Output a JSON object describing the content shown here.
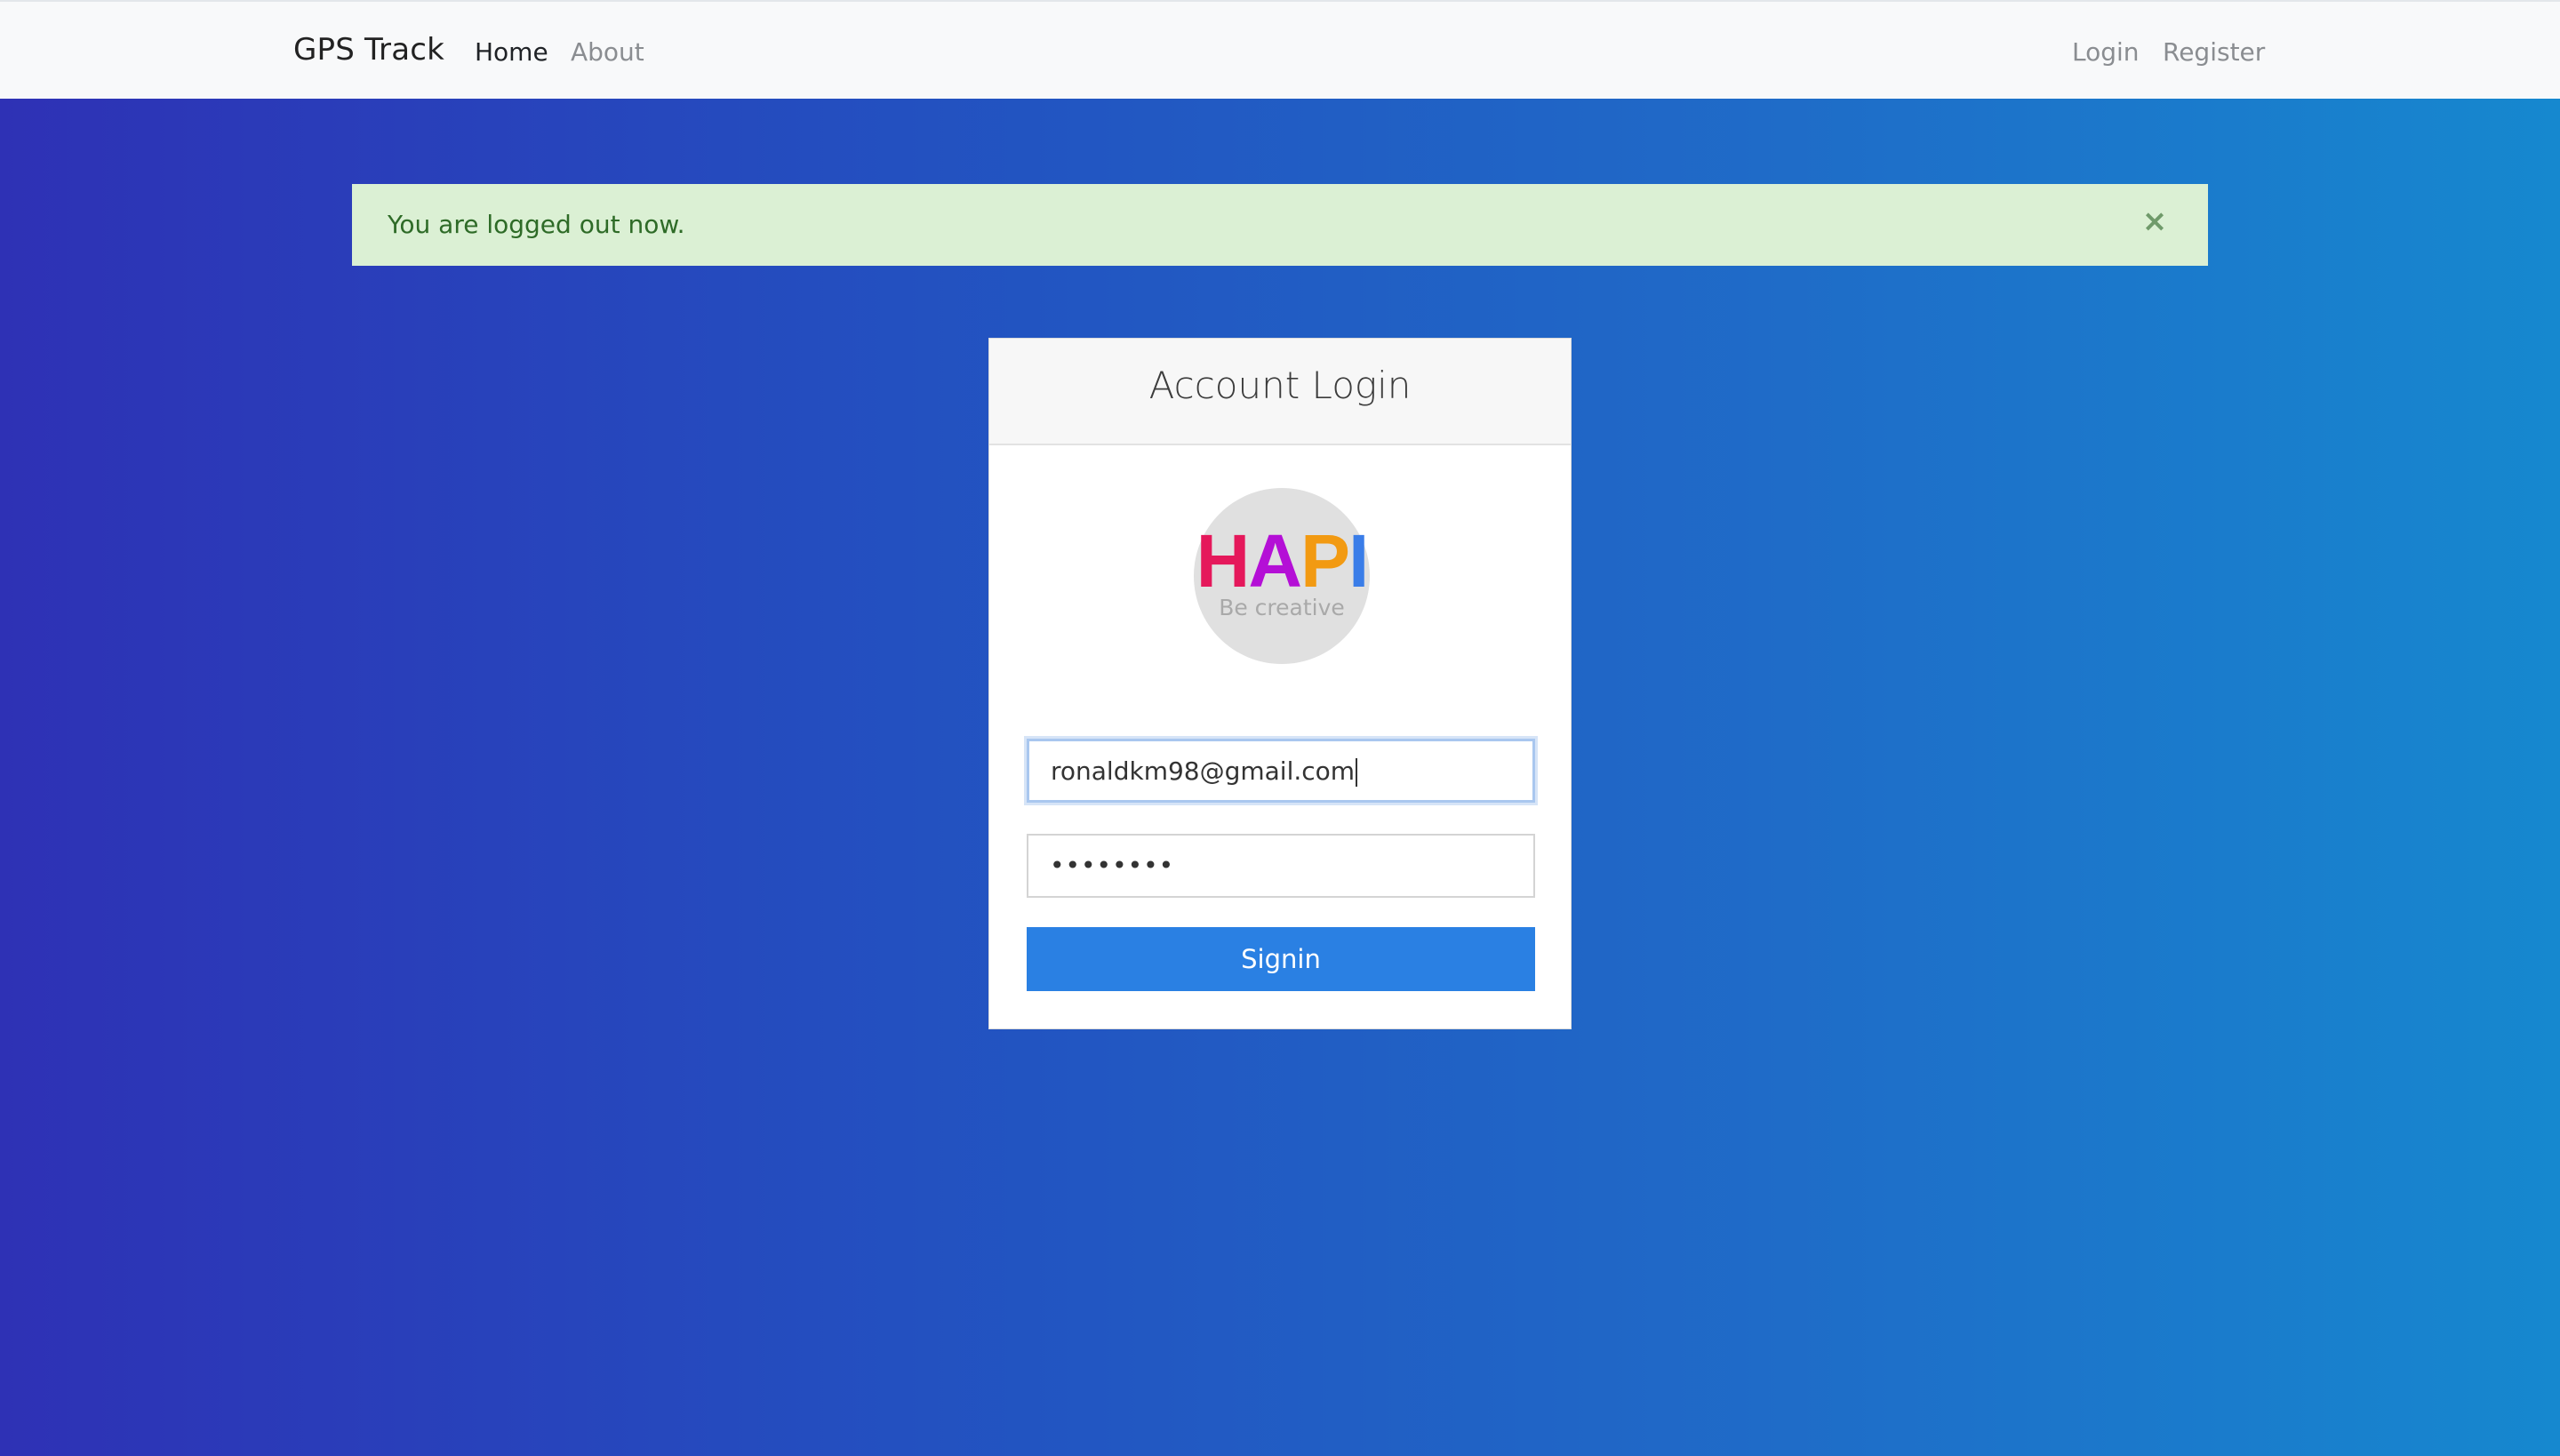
{
  "navbar": {
    "brand": "GPS Track",
    "left_links": [
      {
        "label": "Home",
        "active": true
      },
      {
        "label": "About",
        "active": false
      }
    ],
    "right_links": [
      {
        "label": "Login"
      },
      {
        "label": "Register"
      }
    ]
  },
  "alert": {
    "message": "You are logged out now.",
    "close_glyph": "×",
    "close_icon": "close-icon"
  },
  "login_card": {
    "title": "Account Login",
    "logo": {
      "letters": [
        {
          "char": "H",
          "color": "#e5185b"
        },
        {
          "char": "A",
          "color": "#b40fd6"
        },
        {
          "char": "P",
          "color": "#f29a12"
        },
        {
          "char": "I",
          "color": "#3a7de8"
        }
      ],
      "tagline": "Be creative"
    },
    "email_value": "ronaldkm98@gmail.com",
    "password_masked": "••••••••",
    "submit_label": "Signin"
  },
  "colors": {
    "primary_button": "#2a80e3",
    "alert_bg": "#dbf0d4",
    "alert_text": "#2e6b27",
    "gradient_start": "#2e31b5",
    "gradient_end": "#1688cf"
  }
}
